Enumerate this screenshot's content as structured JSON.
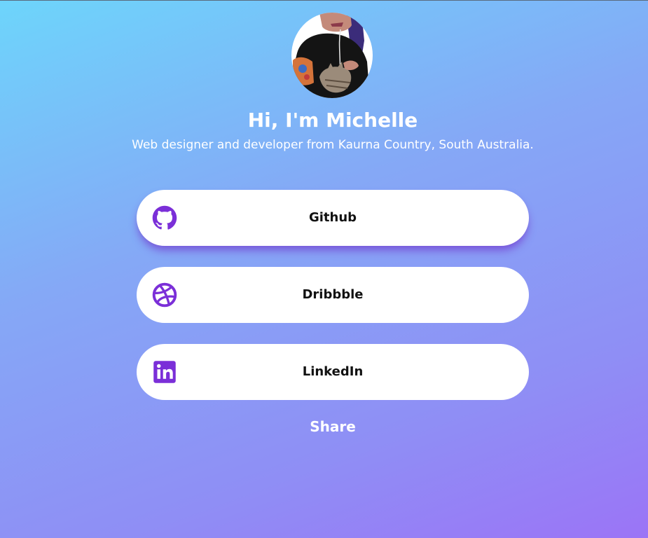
{
  "profile": {
    "name": "Hi, I'm Michelle",
    "tagline": "Web designer and developer from Kaurna Country, South Australia."
  },
  "links": [
    {
      "label": "Github",
      "icon": "github-icon"
    },
    {
      "label": "Dribbble",
      "icon": "dribbble-icon"
    },
    {
      "label": "LinkedIn",
      "icon": "linkedin-icon"
    }
  ],
  "share_label": "Share",
  "colors": {
    "accent": "#7b2fd8",
    "button_bg": "#ffffff",
    "text_light": "#ffffff",
    "text_dark": "#111111"
  }
}
